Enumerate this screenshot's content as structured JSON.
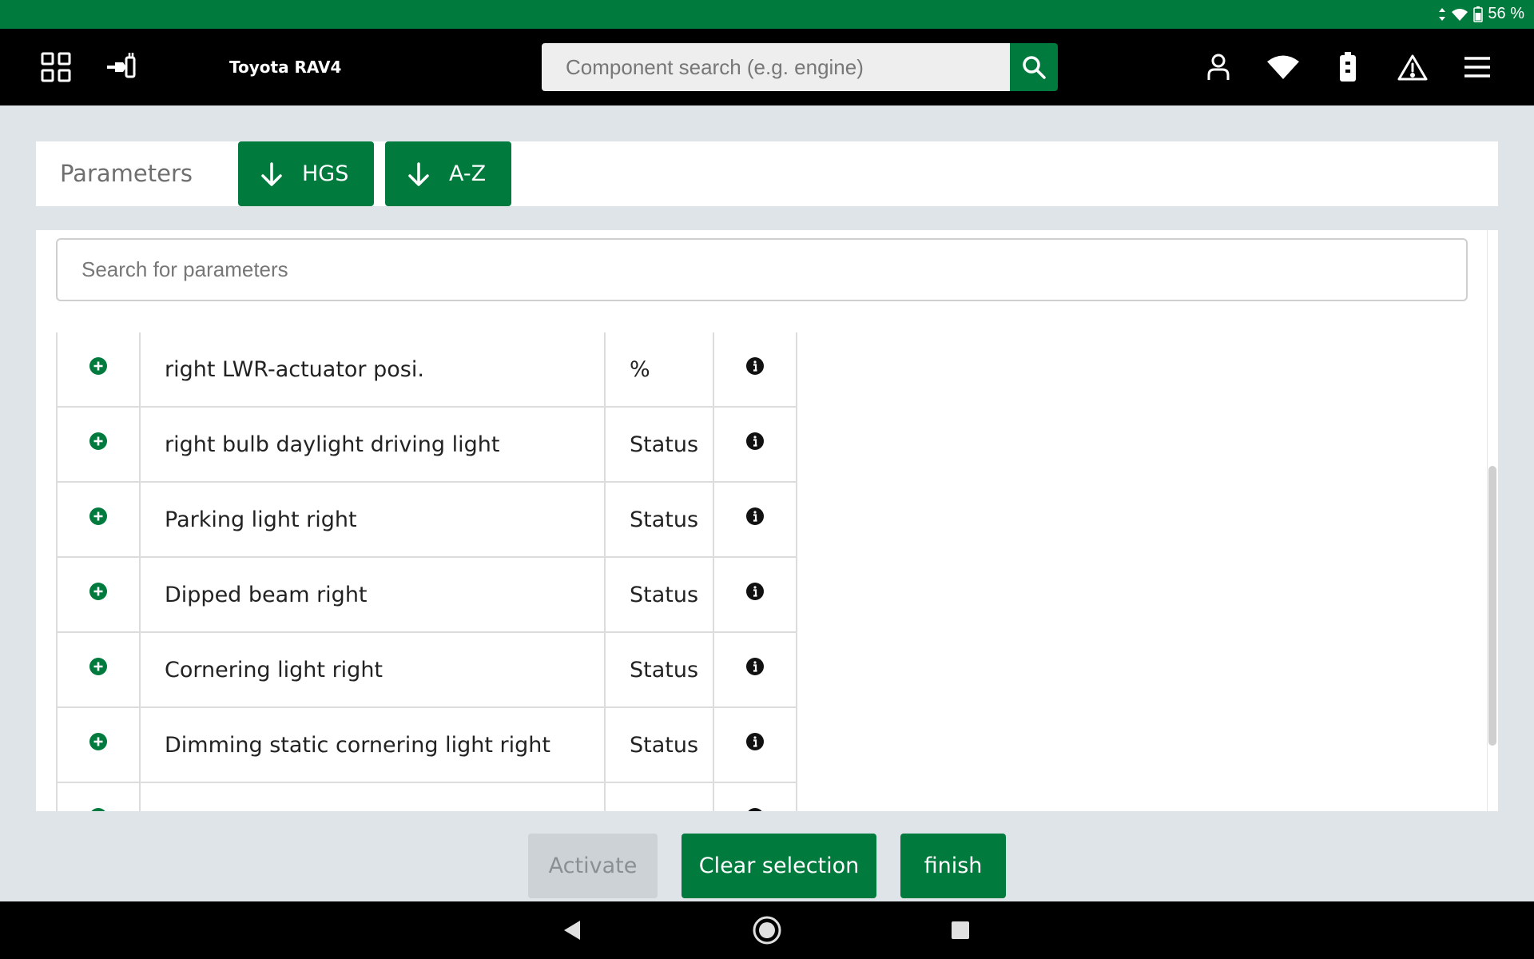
{
  "status_bar": {
    "battery_text": "56 %",
    "icons": [
      "data-arrows-icon",
      "wifi-icon",
      "battery-icon"
    ]
  },
  "header": {
    "vehicle_title": "Toyota RAV4",
    "search_placeholder": "Component search (e.g. engine)",
    "icons": {
      "left": [
        "grid-menu-icon",
        "connector-plug-icon"
      ],
      "search": "search-icon",
      "right": [
        "user-icon",
        "wifi-icon",
        "vci-battery-icon",
        "warning-icon",
        "hamburger-menu-icon"
      ]
    }
  },
  "parameters": {
    "title": "Parameters",
    "sort_buttons": [
      {
        "label": "HGS",
        "icon": "arrow-down-icon"
      },
      {
        "label": "A-Z",
        "icon": "arrow-down-icon"
      }
    ],
    "search_placeholder": "Search for parameters",
    "rows": [
      {
        "name": "right LWR-actuator posi.",
        "unit": "%"
      },
      {
        "name": "right bulb daylight driving light",
        "unit": "Status"
      },
      {
        "name": "Parking light right",
        "unit": "Status"
      },
      {
        "name": "Dipped beam right",
        "unit": "Status"
      },
      {
        "name": "Cornering light right",
        "unit": "Status"
      },
      {
        "name": "Dimming static cornering light right",
        "unit": "Status"
      }
    ]
  },
  "actions": {
    "activate_label": "Activate",
    "clear_label": "Clear selection",
    "finish_label": "finish"
  },
  "nav": {
    "icons": [
      "back-icon",
      "home-icon",
      "recents-icon"
    ]
  },
  "colors": {
    "brand_green": "#007a3d",
    "header_black": "#000000",
    "page_background": "#dfe4e8",
    "disabled_button": "#cdd2d6"
  }
}
